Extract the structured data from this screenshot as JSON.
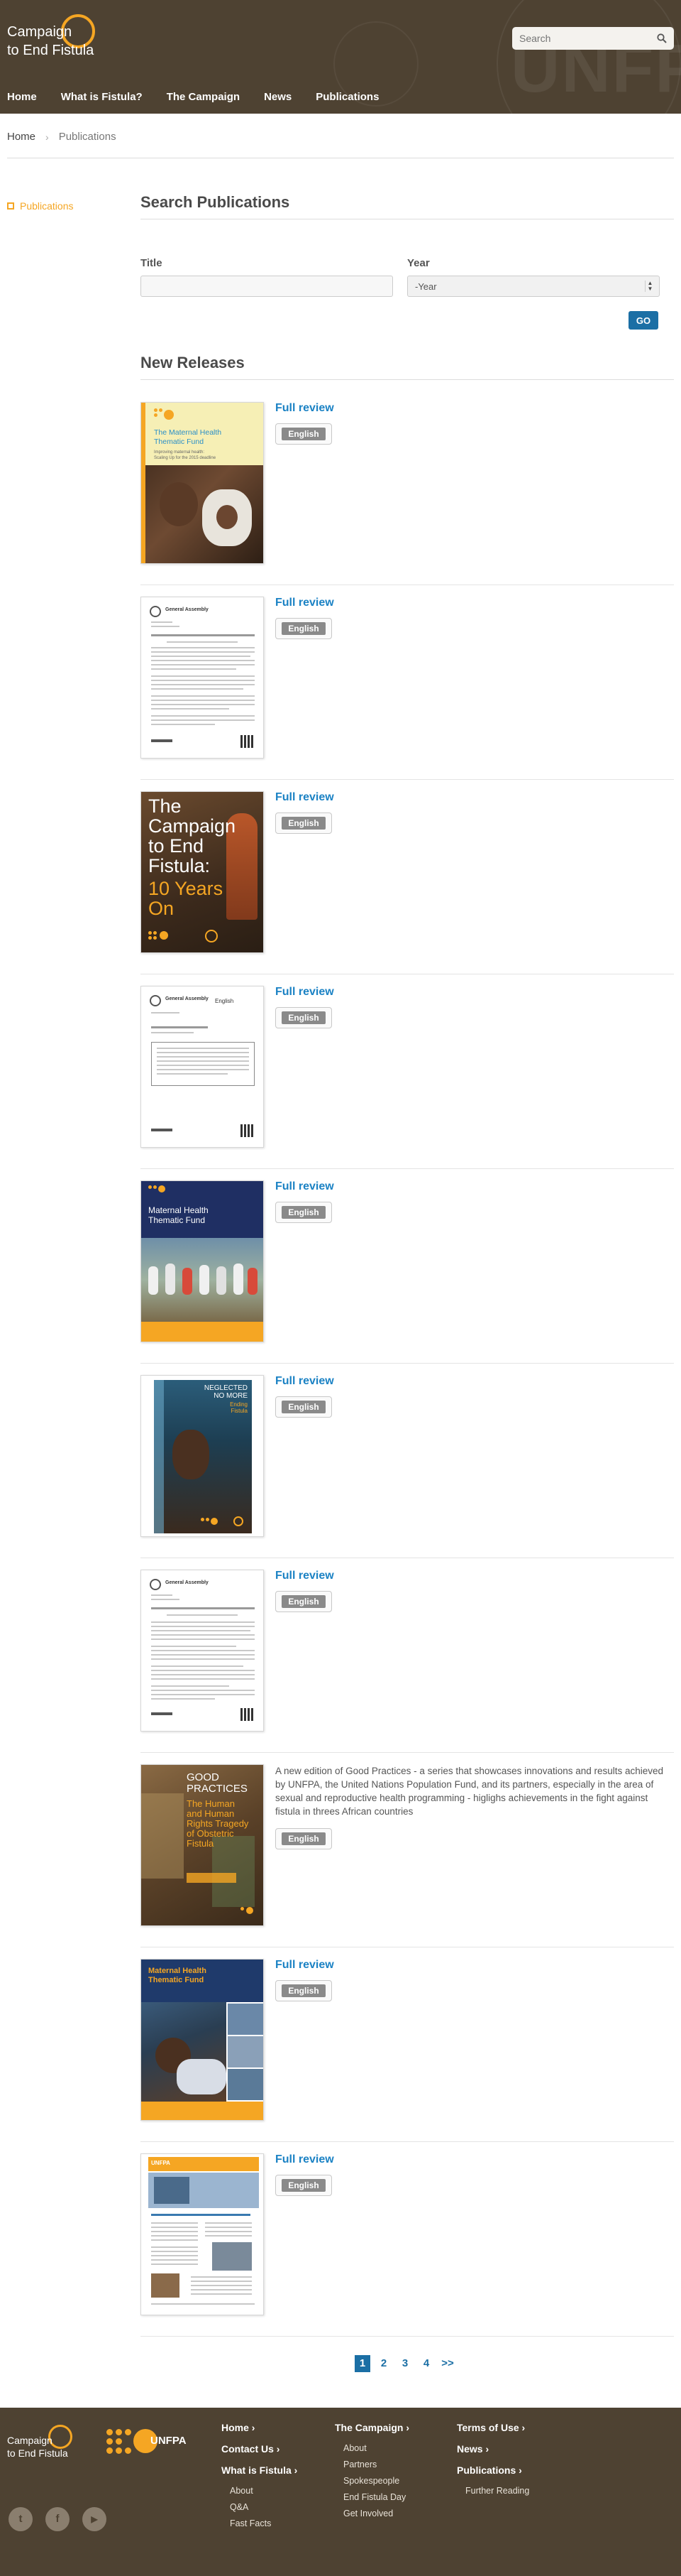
{
  "header": {
    "logo_line1": "Campaign",
    "logo_line2": "to End Fistula",
    "bg_word": "UNFPA",
    "search_placeholder": "Search"
  },
  "nav": [
    "Home",
    "What is Fistula?",
    "The Campaign",
    "News",
    "Publications"
  ],
  "breadcrumb": {
    "home": "Home",
    "current": "Publications"
  },
  "sidenav": {
    "item": "Publications"
  },
  "search_publications": {
    "title": "Search Publications",
    "title_label": "Title",
    "year_label": "Year",
    "year_selected": "-Year",
    "go": "GO"
  },
  "new_releases": {
    "title": "New Releases",
    "items": [
      {
        "link": "Full review",
        "lang": "English",
        "cover": {
          "line1": "The Maternal Health",
          "line2": "Thematic Fund",
          "line3": "Improving maternal health:",
          "line4": "Scaling Up for the 2015 deadline"
        }
      },
      {
        "link": "Full review",
        "lang": "English",
        "cover": {
          "header": "General Assembly"
        }
      },
      {
        "link": "Full review",
        "lang": "English",
        "cover": {
          "line1": "The",
          "line2": "Campaign",
          "line3": "to End",
          "line4": "Fistula:",
          "line5": "10 Years",
          "line6": "On"
        }
      },
      {
        "link": "Full review",
        "lang": "English",
        "cover": {
          "header": "General Assembly",
          "sub": "English"
        }
      },
      {
        "link": "Full review",
        "lang": "English",
        "cover": {
          "line1": "Maternal Health",
          "line2": "Thematic Fund"
        }
      },
      {
        "link": "Full review",
        "lang": "English",
        "cover": {
          "line1": "NEGLECTED",
          "line2": "NO MORE",
          "line3": "Ending",
          "line4": "Fistula"
        }
      },
      {
        "link": "Full review",
        "lang": "English",
        "cover": {
          "header": "General Assembly"
        }
      },
      {
        "description": "A new edition of Good Practices - a series that showcases innovations and results achieved by UNFPA, the United Nations Population Fund, and its partners, especially in the area of sexual and reproductive health programming - higlighs achievements in the fight against fistula in threes African countries",
        "lang": "English",
        "cover": {
          "line1": "GOOD",
          "line2": "PRACTICES",
          "line3": "The Human",
          "line4": "and Human",
          "line5": "Rights Tragedy",
          "line6": "of Obstetric",
          "line7": "Fistula"
        }
      },
      {
        "link": "Full review",
        "lang": "English",
        "cover": {
          "line1": "Maternal Health",
          "line2": "Thematic Fund"
        }
      },
      {
        "link": "Full review",
        "lang": "English",
        "cover": {
          "line1": "UNFPA"
        }
      }
    ]
  },
  "pagination": {
    "pages": [
      "1",
      "2",
      "3",
      "4"
    ],
    "next": ">>"
  },
  "footer": {
    "logo_line1": "Campaign",
    "logo_line2": "to End Fistula",
    "unfpa": "UNFPA",
    "social": [
      "t",
      "f",
      "▶"
    ],
    "col1": {
      "home": "Home",
      "contact": "Contact Us",
      "fistula": "What is Fistula",
      "links": [
        "About",
        "Q&A",
        "Fast Facts"
      ]
    },
    "col2": {
      "campaign": "The Campaign",
      "links": [
        "About",
        "Partners",
        "Spokespeople",
        "End Fistula Day",
        "Get Involved"
      ]
    },
    "col3": {
      "terms": "Terms of Use",
      "news": "News",
      "publications": "Publications",
      "links": [
        "Further Reading"
      ]
    }
  },
  "colors": {
    "header_bg": "#4e4232",
    "accent_orange": "#f5a623",
    "link_blue": "#1b82c4",
    "button_blue": "#1b6fa5"
  }
}
